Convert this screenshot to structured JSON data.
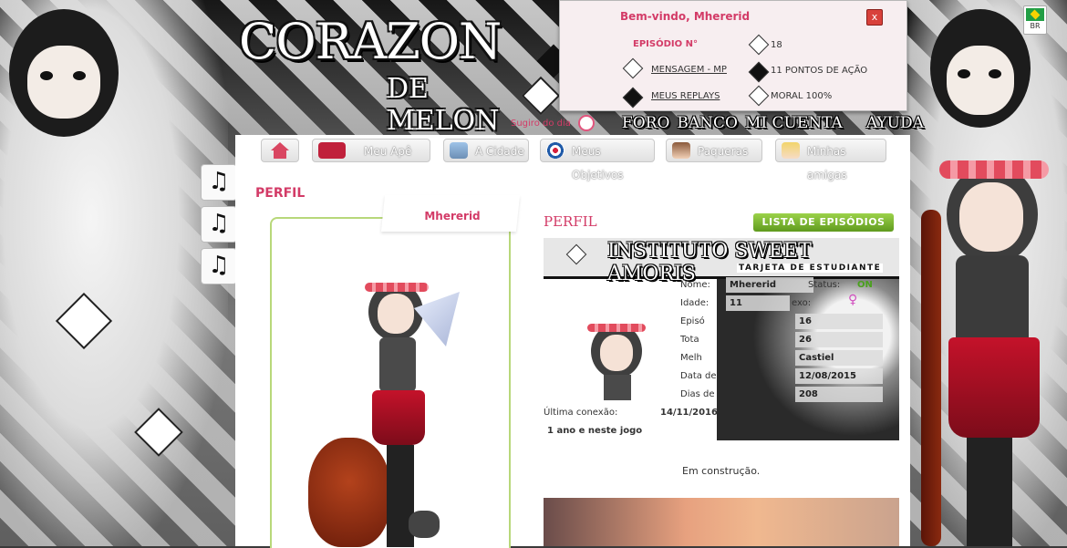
{
  "site": {
    "logo_main": "CORAZON",
    "logo_sub": "DE MELON"
  },
  "top_nav": {
    "suggest_label": "Sugiro do dia",
    "links": [
      "FORO",
      "BANCO",
      "MI CUENTA",
      "AYUDA"
    ]
  },
  "welcome_panel": {
    "title": "Bem-vindo, Mhererid",
    "close": "x",
    "episode_label": "EPISÓDIO N°",
    "episode_value": "18",
    "messages_label": "MENSAGEM - MP",
    "action_points": "11 PONTOS DE AÇÃO",
    "replays_label": "MEUS REPLAYS",
    "moral": "MORAL 100%"
  },
  "language": {
    "code": "BR"
  },
  "music_buttons": [
    "♫",
    "♫",
    "♫"
  ],
  "tabs": [
    {
      "label": "",
      "icon": "home-icon"
    },
    {
      "label": "Meu Apê",
      "icon": "sofa-icon"
    },
    {
      "label": "A Cidade",
      "icon": "city-icon"
    },
    {
      "label": "Meus Objetivos",
      "icon": "target-icon"
    },
    {
      "label": "Paqueras",
      "icon": "boy-portrait-icon"
    },
    {
      "label": "Minhas amigas",
      "icon": "girl-portrait-icon"
    }
  ],
  "profile": {
    "heading": "PERFIL",
    "username": "Mhererid",
    "section_title": "PERFIL",
    "episodes_button": "LISTA DE EPISÓDIOS",
    "status_text": "Em construção."
  },
  "student_card": {
    "title": "INSTITUTO SWEET AMORIS",
    "subtitle": "TARJETA DE ESTUDIANTE",
    "rows": [
      {
        "label": "Nome:",
        "value": "Mhererid"
      },
      {
        "label": "Idade:",
        "value": "11"
      },
      {
        "label": "Episó",
        "value": "16"
      },
      {
        "label": "Tota",
        "value": "26"
      },
      {
        "label": "Melh",
        "value": "Castiel"
      },
      {
        "label": "Data de",
        "value": "12/08/2015"
      },
      {
        "label": "Dias de",
        "value": "208"
      }
    ],
    "status_label": "Status:",
    "status_value": "ON",
    "sex_label": "exo:",
    "last_connection_label": "Última conexão:",
    "last_connection_value": "14/11/2016",
    "tenure": "1 ano e neste jogo"
  },
  "colors": {
    "accent_pink": "#d33b67",
    "green_button": "#6fae28",
    "online_green": "#4aa11d"
  }
}
